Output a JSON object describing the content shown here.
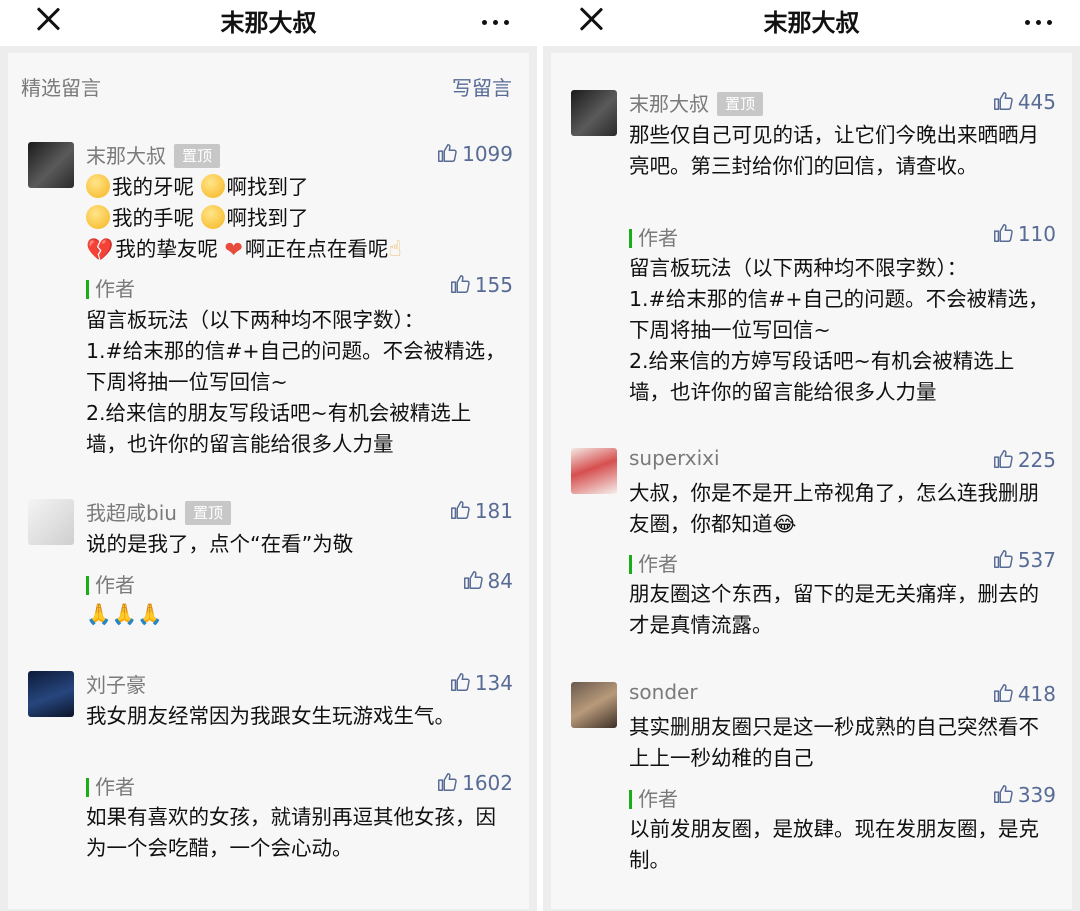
{
  "left": {
    "title": "末那大叔",
    "section_title": "精选留言",
    "write_label": "写留言",
    "comments": [
      {
        "nick": "末那大叔",
        "pinned": "置顶",
        "likes": "1099",
        "lines": [
          {
            "e1": "我的牙呢",
            "e2": "啊找到了"
          },
          {
            "e1": "我的手呢",
            "e2": "啊找到了"
          },
          {
            "e1": "我的挚友呢",
            "e2": "啊正在点在看呢"
          }
        ],
        "reply_label": "作者",
        "reply_likes": "155",
        "reply": "留言板玩法（以下两种均不限字数）：\n1.#给末那的信#+自己的问题。不会被精选，下周将抽一位写回信~\n2.给来信的朋友写段话吧~有机会被精选上墙，也许你的留言能给很多人力量"
      },
      {
        "nick": "我超咸biu",
        "pinned": "置顶",
        "likes": "181",
        "text": "说的是我了，点个“在看”为敬",
        "reply_label": "作者",
        "reply_likes": "84",
        "reply_emoji": "🙏🙏🙏"
      },
      {
        "nick": "刘子豪",
        "likes": "134",
        "text": "我女朋友经常因为我跟女生玩游戏生气。",
        "reply_label": "作者",
        "reply_likes": "1602",
        "reply": "如果有喜欢的女孩，就请别再逗其他女孩，因为一个会吃醋，一个会心动。"
      }
    ]
  },
  "right": {
    "title": "末那大叔",
    "comments": [
      {
        "nick": "末那大叔",
        "pinned": "置顶",
        "likes": "445",
        "text": "那些仅自己可见的话，让它们今晚出来晒晒月亮吧。第三封给你们的回信，请查收。",
        "reply_label": "作者",
        "reply_likes": "110",
        "reply": "留言板玩法（以下两种均不限字数）：\n1.#给末那的信#+自己的问题。不会被精选，下周将抽一位写回信~\n2.给来信的方婷写段话吧~有机会被精选上墙，也许你的留言能给很多人力量"
      },
      {
        "nick": "superxixi",
        "likes": "225",
        "text": "大叔，你是不是开上帝视角了，怎么连我删朋友圈，你都知道😂",
        "reply_label": "作者",
        "reply_likes": "537",
        "reply": "朋友圈这个东西，留下的是无关痛痒，删去的才是真情流露。"
      },
      {
        "nick": "sonder",
        "likes": "418",
        "text": "其实删朋友圈只是这一秒成熟的自己突然看不上上一秒幼稚的自己",
        "reply_label": "作者",
        "reply_likes": "339",
        "reply": "以前发朋友圈，是放肆。现在发朋友圈，是克制。"
      }
    ]
  }
}
